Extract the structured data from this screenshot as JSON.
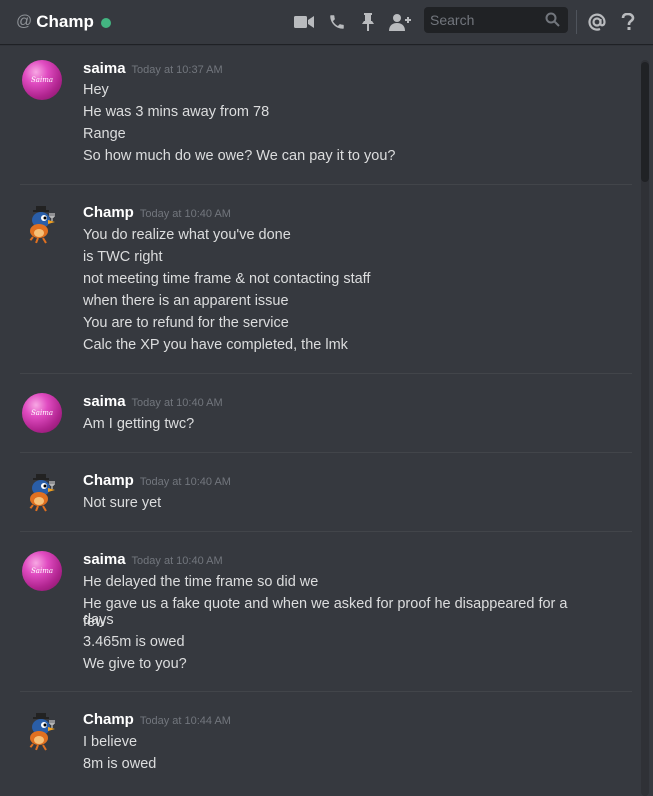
{
  "header": {
    "at_symbol": "@",
    "channel_name": "Champ",
    "status_color": "#43b581",
    "icons": [
      "video-call-icon",
      "phone-call-icon",
      "pin-icon",
      "add-friend-icon",
      "mention-icon",
      "help-icon"
    ],
    "search_placeholder": "Search"
  },
  "users": {
    "saima": {
      "name": "saima",
      "avatar_text": "Saima"
    },
    "champ": {
      "name": "Champ"
    }
  },
  "messages": [
    {
      "author": "saima",
      "timestamp": "Today at 10:37 AM",
      "lines": [
        "Hey",
        "He was 3 mins away from 78",
        "Range",
        "So how much do we owe? We can pay it to you?"
      ]
    },
    {
      "author": "Champ",
      "timestamp": "Today at 10:40 AM",
      "lines": [
        "You do realize what you've done",
        "is TWC right",
        "not meeting time frame & not contacting staff",
        "when there is an apparent issue",
        "You are to refund for the service",
        "Calc the XP you have completed, the lmk"
      ]
    },
    {
      "author": "saima",
      "timestamp": "Today at 10:40 AM",
      "lines": [
        "Am I getting twc?"
      ]
    },
    {
      "author": "Champ",
      "timestamp": "Today at 10:40 AM",
      "lines": [
        "Not sure yet"
      ]
    },
    {
      "author": "saima",
      "timestamp": "Today at 10:40 AM",
      "lines": [
        "He delayed the time frame so did we",
        "He gave us a fake quote and when we asked for proof he disappeared for a few",
        "days",
        "3.465m is owed",
        "We give to you?"
      ]
    },
    {
      "author": "Champ",
      "timestamp": "Today at 10:44 AM",
      "lines": [
        "I believe",
        "8m is owed"
      ]
    }
  ]
}
